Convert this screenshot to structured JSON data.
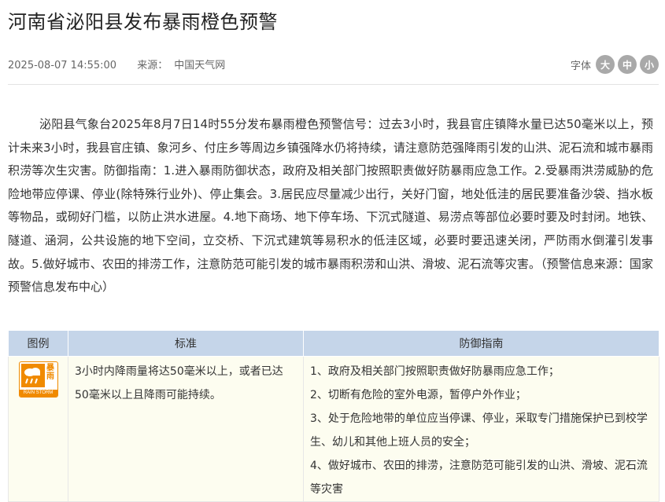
{
  "article": {
    "title": "河南省泌阳县发布暴雨橙色预警",
    "datetime": "2025-08-07 14:55:00",
    "source_label": "来源：",
    "source": "中国天气网",
    "body": "泌阳县气象台2025年8月7日14时55分发布暴雨橙色预警信号：过去3小时，我县官庄镇降水量已达50毫米以上，预计未来3小时，我县官庄镇、象河乡、付庄乡等周边乡镇强降水仍将持续，请注意防范强降雨引发的山洪、泥石流和城市暴雨积涝等次生灾害。防御指南：1.进入暴雨防御状态，政府及相关部门按照职责做好防暴雨应急工作。2.受暴雨洪涝威胁的危险地带应停课、停业(除特殊行业外)、停止集会。3.居民应尽量减少出行，关好门窗，地处低洼的居民要准备沙袋、挡水板等物品，或砌好门槛，以防止洪水进屋。4.地下商场、地下停车场、下沉式隧道、易涝点等部位必要时要及时封闭。地铁、隧道、涵洞，公共设施的地下空间，立交桥、下沉式建筑等易积水的低洼区域，必要时要迅速关闭，严防雨水倒灌引发事故。5.做好城市、农田的排涝工作，注意防范可能引发的城市暴雨积涝和山洪、滑坡、泥石流等灾害。（预警信息来源：国家预警信息发布中心）"
  },
  "font_size": {
    "label": "字体",
    "large": "大",
    "medium": "中",
    "small": "小"
  },
  "table": {
    "headers": [
      "图例",
      "标准",
      "防御指南"
    ],
    "icon": {
      "name": "rainstorm-orange-icon",
      "chars": "暴雨",
      "en": "RAIN STORM",
      "color": "#f08a00"
    },
    "standard": "3小时内降雨量将达50毫米以上，或者已达50毫米以上且降雨可能持续。",
    "guidelines": [
      "1、政府及相关部门按照职责做好防暴雨应急工作；",
      "2、切断有危险的室外电源，暂停户外作业；",
      "3、处于危险地带的单位应当停课、停业，采取专门措施保护已到校学生、幼儿和其他上班人员的安全；",
      "4、做好城市、农田的排涝，注意防范可能引发的山洪、滑坡、泥石流等灾害"
    ]
  }
}
